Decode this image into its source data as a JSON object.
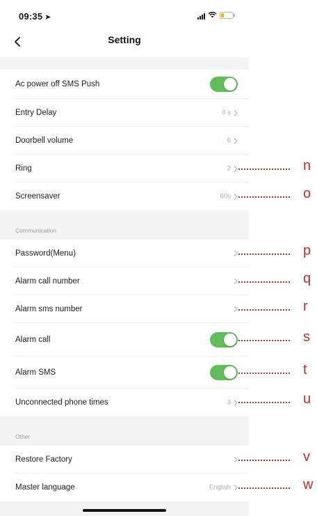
{
  "status_bar": {
    "time": "09:35",
    "location_icon": "location-arrow-icon",
    "signal_icon": "signal-icon",
    "wifi_icon": "wifi-icon",
    "battery_icon": "battery-icon",
    "battery_color": "#f2b705"
  },
  "header": {
    "title": "Setting",
    "back_icon": "chevron-left-icon"
  },
  "sections": {
    "communication_label": "Communication",
    "other_label": "Other"
  },
  "rows": {
    "ac_power_sms": {
      "label": "Ac power off SMS Push",
      "toggle_on": true
    },
    "entry_delay": {
      "label": "Entry Delay",
      "value": "0 s"
    },
    "doorbell_volume": {
      "label": "Doorbell volume",
      "value": "6"
    },
    "ring": {
      "label": "Ring",
      "value": "2"
    },
    "screensaver": {
      "label": "Screensaver",
      "value": "60s"
    },
    "password_menu": {
      "label": "Password(Menu)",
      "value": ""
    },
    "alarm_call_number": {
      "label": "Alarm call number",
      "value": ""
    },
    "alarm_sms_number": {
      "label": "Alarm sms number",
      "value": ""
    },
    "alarm_call": {
      "label": "Alarm call",
      "toggle_on": true
    },
    "alarm_sms": {
      "label": "Alarm SMS",
      "toggle_on": true
    },
    "unconnected_phone_times": {
      "label": "Unconnected phone times",
      "value": "3"
    },
    "restore_factory": {
      "label": "Restore Factory",
      "value": ""
    },
    "master_language": {
      "label": "Master language",
      "value": "English"
    }
  },
  "annotations": {
    "n": "n",
    "o": "o",
    "p": "p",
    "q": "q",
    "r": "r",
    "s": "s",
    "t": "t",
    "u": "u",
    "v": "v",
    "w": "w"
  },
  "colors": {
    "toggle_on": "#5fbe5a",
    "annotation": "#b8302a",
    "section_background": "#f4f4f4"
  }
}
